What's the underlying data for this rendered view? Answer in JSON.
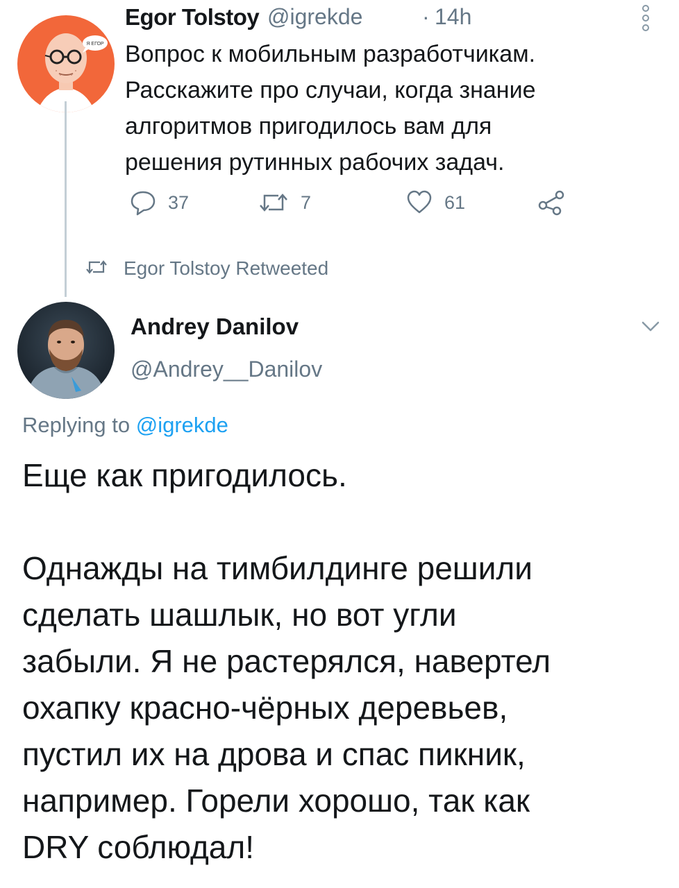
{
  "parent_tweet": {
    "author_name": "Egor Tolstoy",
    "handle": "@igrekde",
    "separator": "·",
    "time": "14h",
    "avatar_bubble_text": "Я ЕГОР",
    "text_lines": [
      "Вопрос к мобильным разработчикам.",
      "Расскажите про случаи, когда знание",
      "алгоритмов пригодилось вам для",
      "решения рутинных рабочих задач."
    ],
    "actions": {
      "replies": "37",
      "retweets": "7",
      "likes": "61"
    }
  },
  "retweet_context": {
    "text": "Egor Tolstoy Retweeted"
  },
  "main_tweet": {
    "author_name": "Andrey Danilov",
    "handle": "@Andrey__Danilov",
    "replying_prefix": "Replying to ",
    "replying_handle": "@igrekde",
    "lines_p1": [
      "Еще как пригодилось."
    ],
    "lines_p2": [
      "Однажды на тимбилдинге решили",
      "сделать шашлык, но вот угли",
      "забыли. Я не растерялся, навертел",
      "охапку красно-чёрных деревьев,",
      "пустил их на дрова и спас пикник,",
      "например. Горели хорошо, так как",
      "DRY соблюдал!"
    ]
  },
  "colors": {
    "accent": "#1da1f2",
    "secondary_text": "#657786",
    "avatar1_bg": "#f2673a",
    "thread_line": "#c4cfd6"
  }
}
